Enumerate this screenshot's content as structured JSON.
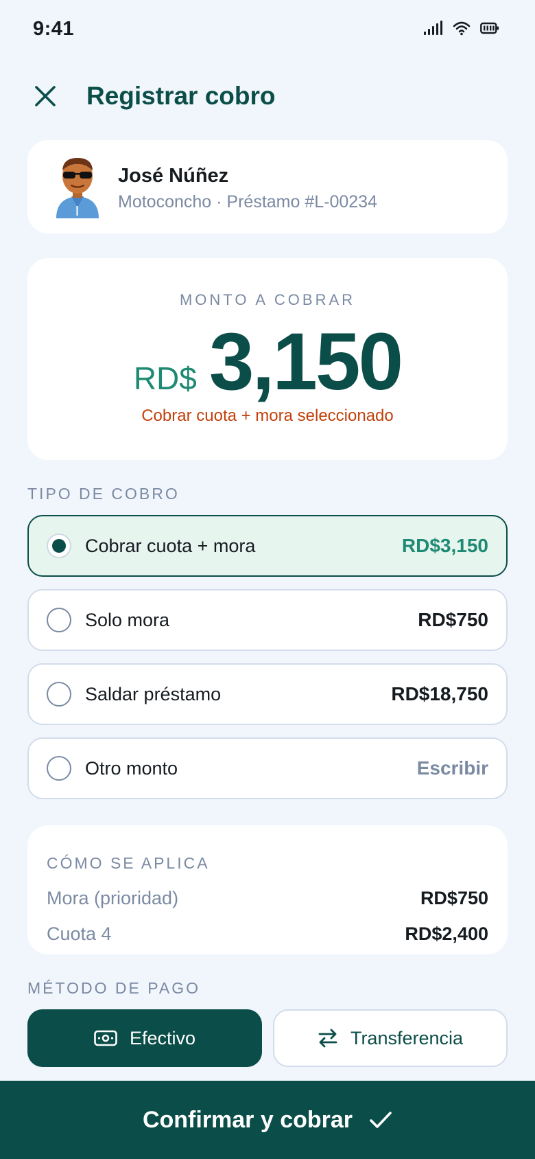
{
  "status": {
    "time": "9:41"
  },
  "header": {
    "title": "Registrar cobro"
  },
  "client": {
    "name": "José Núñez",
    "meta": "Motoconcho · Préstamo #L-00234"
  },
  "amount": {
    "label": "MONTO A COBRAR",
    "currency": "RD$",
    "value": "3,150",
    "note": "Cobrar cuota + mora seleccionado"
  },
  "collection_type": {
    "label": "TIPO DE COBRO",
    "options": [
      {
        "label": "Cobrar cuota + mora",
        "value": "RD$3,150",
        "selected": true
      },
      {
        "label": "Solo mora",
        "value": "RD$750",
        "selected": false
      },
      {
        "label": "Saldar préstamo",
        "value": "RD$18,750",
        "selected": false
      },
      {
        "label": "Otro monto",
        "value": "Escribir",
        "selected": false
      }
    ]
  },
  "application": {
    "title": "CÓMO SE APLICA",
    "rows": [
      {
        "key": "Mora (prioridad)",
        "value": "RD$750"
      },
      {
        "key": "Cuota 4",
        "value": "RD$2,400"
      }
    ]
  },
  "payment_method": {
    "label": "MÉTODO DE PAGO",
    "options": [
      {
        "label": "Efectivo",
        "icon": "cash-icon",
        "selected": true
      },
      {
        "label": "Transferencia",
        "icon": "transfer-arrows-icon",
        "selected": false
      }
    ]
  },
  "confirm": {
    "label": "Confirmar y cobrar",
    "icon": "check-icon"
  },
  "colors": {
    "primary": "#0b4d48",
    "accent": "#1f8a73",
    "warning": "#c2410c",
    "background": "#f1f6fc"
  }
}
